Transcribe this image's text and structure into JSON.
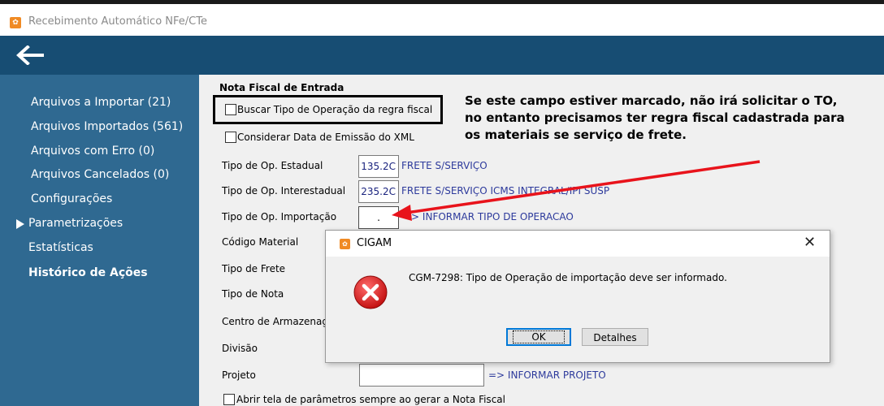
{
  "window": {
    "title": "Recebimento Automático NFe/CTe",
    "app_icon": "cigam-logo-icon"
  },
  "header": {
    "back_icon": "back-arrow-icon"
  },
  "sidebar": {
    "items": [
      {
        "label": "Arquivos a Importar (21)"
      },
      {
        "label": "Arquivos Importados (561)"
      },
      {
        "label": "Arquivos com Erro (0)"
      },
      {
        "label": "Arquivos Cancelados (0)"
      },
      {
        "label": "Configurações"
      },
      {
        "label": "Parametrizações"
      },
      {
        "label": "Estatísticas"
      },
      {
        "label": "Histórico de Ações"
      }
    ]
  },
  "form": {
    "section_title": "Nota Fiscal de Entrada",
    "chk_buscar": "Buscar Tipo de Operação da regra fiscal",
    "chk_considerar": "Considerar Data de Emissão do XML",
    "estadual": {
      "label": "Tipo de Op. Estadual",
      "value": "135.2C",
      "desc": "FRETE S/SERVIÇO"
    },
    "interestadual": {
      "label": "Tipo de Op. Interestadual",
      "value": "235.2C",
      "desc": "FRETE S/SERVIÇO ICMS INTEGRAL/IPI SUSP"
    },
    "importacao": {
      "label": "Tipo de Op. Importação",
      "value": ".",
      "desc": "=> INFORMAR TIPO DE OPERACAO"
    },
    "codigo_material": "Código Material",
    "tipo_frete": "Tipo de Frete",
    "tipo_nota": "Tipo de Nota",
    "centro": "Centro de Armazenag",
    "divisao": "Divisão",
    "projeto": {
      "label": "Projeto",
      "value": "",
      "desc": "=> INFORMAR PROJETO"
    },
    "chk_abrir": "Abrir tela de parâmetros sempre ao gerar a Nota Fiscal"
  },
  "annotation": {
    "lines": [
      "Se este campo estiver marcado, não irá solicitar o TO,",
      "no entanto precisamos ter regra fiscal cadastrada para",
      "os materiais se serviço de frete."
    ],
    "arrow_color": "#e8131b"
  },
  "dialog": {
    "title": "CIGAM",
    "message": "CGM-7298: Tipo de Operação de importação deve ser informado.",
    "ok_label": "OK",
    "details_label": "Detalhes",
    "close_icon": "close-icon",
    "error_icon": "error-icon"
  },
  "colors": {
    "header": "#174d73",
    "sidebar": "#2f6991",
    "content": "#f0f0f0",
    "link_text": "#2d3a9c"
  }
}
